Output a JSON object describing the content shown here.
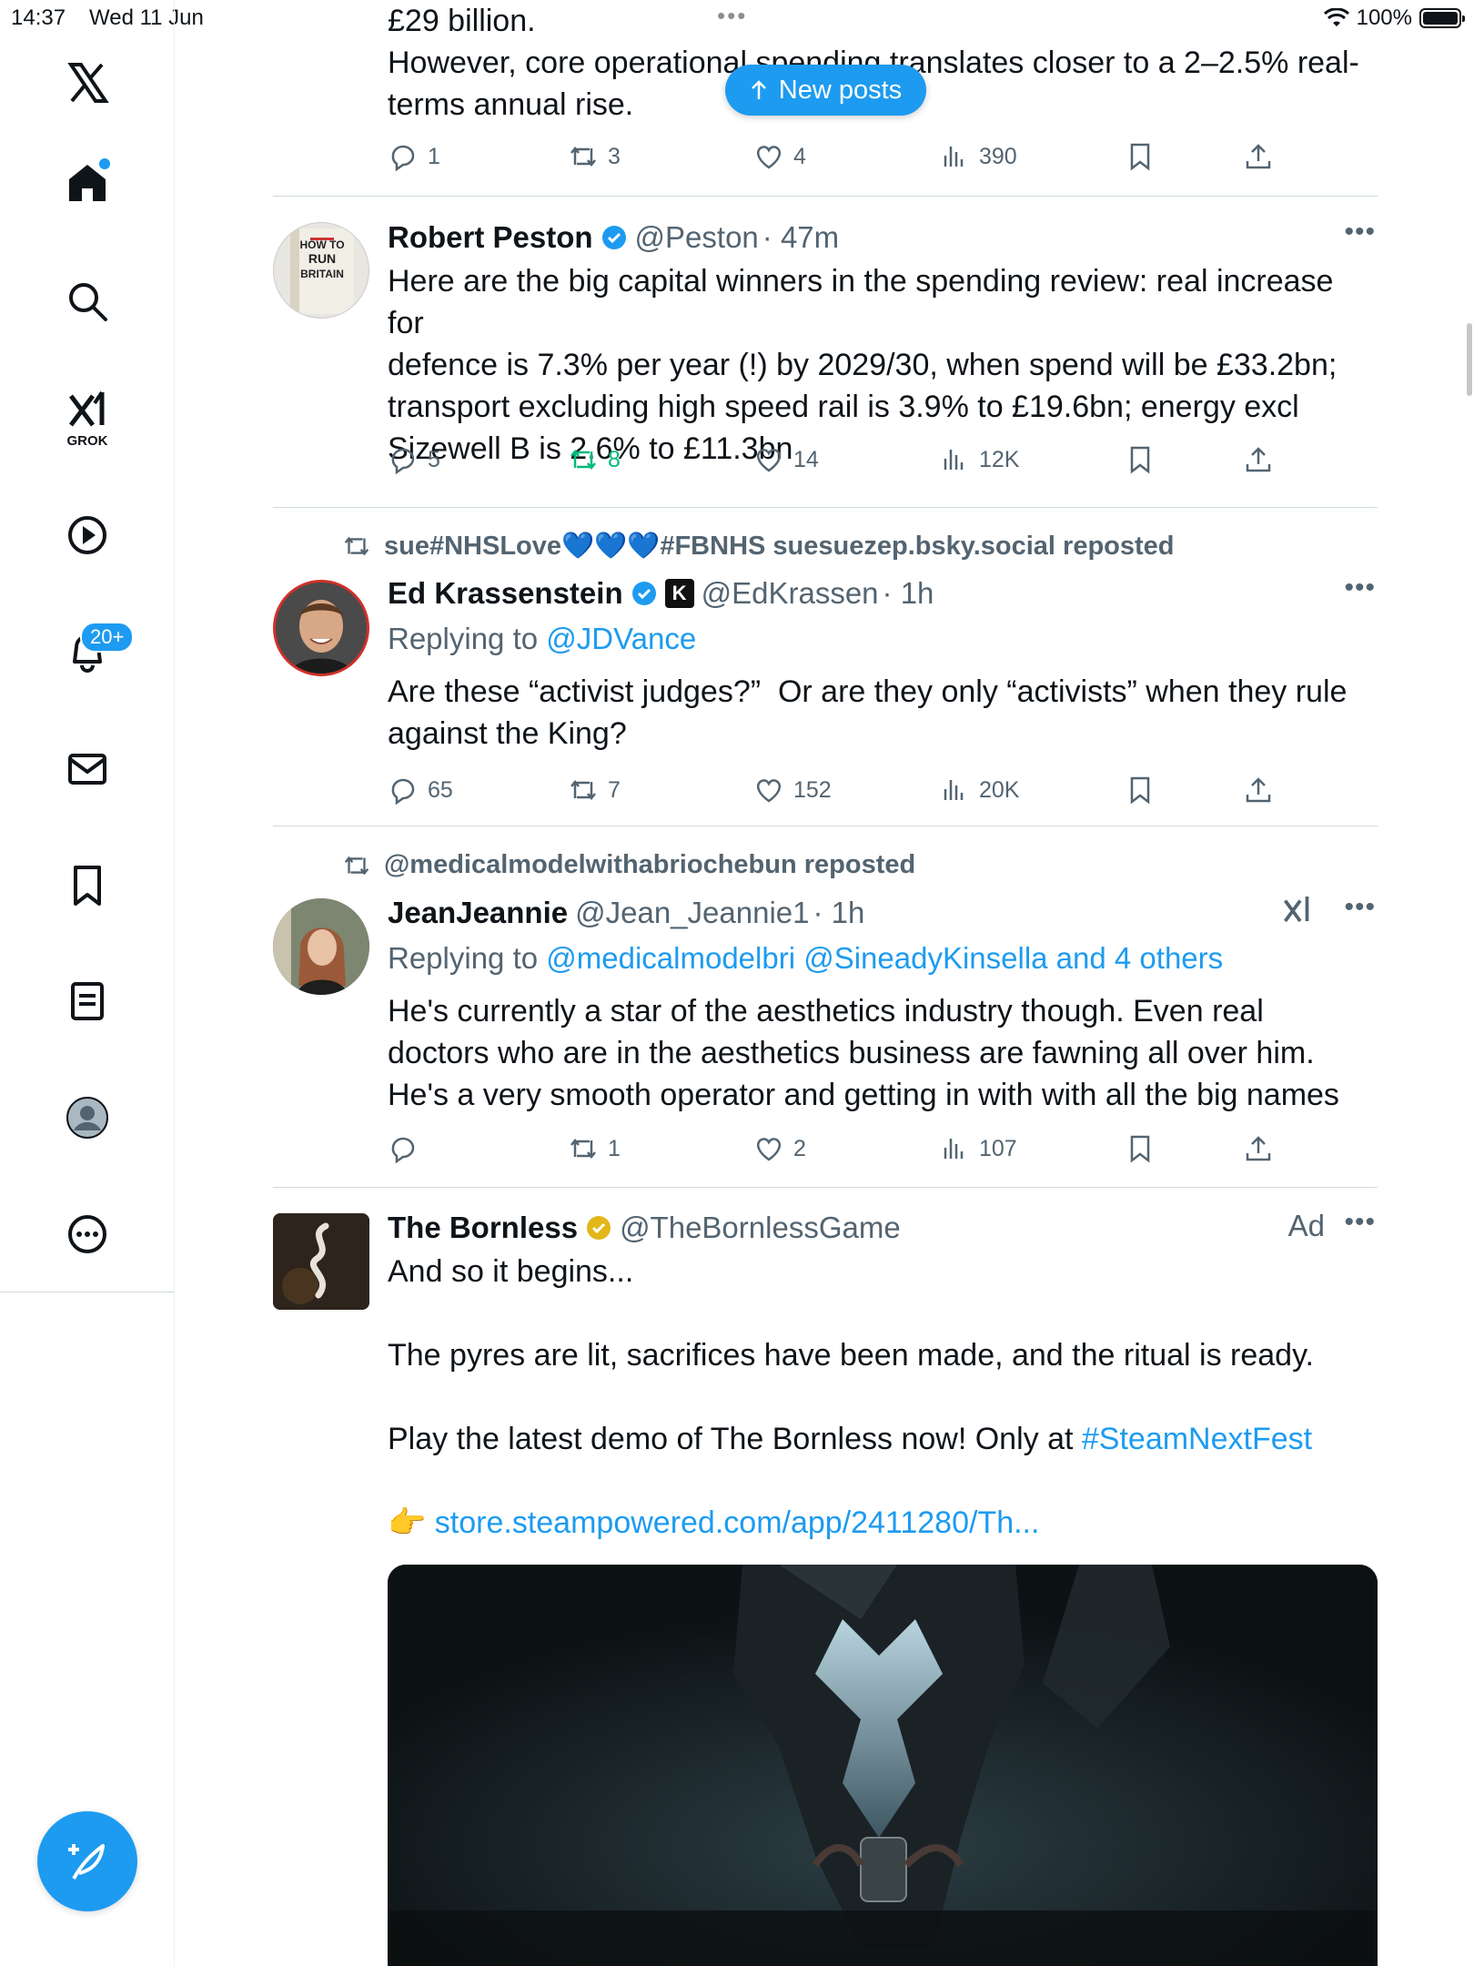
{
  "status": {
    "time": "14:37",
    "date": "Wed 11 Jun",
    "battery": "100%",
    "dots": "•••"
  },
  "nav": {
    "notif_count": "20+",
    "grok_label": "GROK"
  },
  "new_posts_label": "New posts",
  "top_tweet": {
    "line1": "£29 billion.",
    "line2": "However, core operational spending translates closer to a 2–2.5% real-",
    "line3": "terms annual rise.",
    "replies": "1",
    "reposts": "3",
    "likes": "4",
    "views": "390"
  },
  "tweets": [
    {
      "name": "Robert Peston",
      "handle": "@Peston",
      "time": "· 47m",
      "avatar_text": "HOW TO RUN BRITAIN",
      "lines": [
        "Here are the big capital winners in the spending review: real increase for",
        "defence is 7.3% per year (!) by 2029/30, when spend will be £33.2bn;",
        "transport excluding high speed rail is 3.9% to £19.6bn; energy excl",
        "Sizewell B is 2.6% to £11.3bn"
      ],
      "replies": "5",
      "reposts": "8",
      "likes": "14",
      "views": "12K"
    },
    {
      "repost_by": "sue#NHSLove💙💙💙#FBNHS suesuezep.bsky.social reposted",
      "name": "Ed Krassenstein",
      "badge": "K",
      "handle": "@EdKrassen",
      "time": "· 1h",
      "reply_prefix": "Replying to ",
      "reply_to": "@JDVance",
      "lines": [
        "Are these “activist judges?”  Or are they only “activists” when they rule",
        "against the King?"
      ],
      "replies": "65",
      "reposts": "7",
      "likes": "152",
      "views": "20K"
    },
    {
      "repost_by": "@medicalmodelwithabriochebun reposted",
      "name": "JeanJeannie",
      "handle": "@Jean_Jeannie1",
      "time": "· 1h",
      "reply_prefix": "Replying to ",
      "reply_to": "@medicalmodelbri @SineadyKinsella and 4 others",
      "lines": [
        "He's currently a star of the aesthetics industry though. Even real",
        "doctors who are in the aesthetics business are fawning all over him.",
        "He's a very smooth operator and getting in with with all the big names"
      ],
      "replies": "",
      "reposts": "1",
      "likes": "2",
      "views": "107"
    },
    {
      "name": "The Bornless",
      "handle": "@TheBornlessGame",
      "ad_label": "Ad",
      "line1": "And so it begins...",
      "line2": "The pyres are lit, sacrifices have been made, and the ritual is ready.",
      "line3_prefix": "Play the latest demo of The Bornless now! Only at ",
      "hashtag": "#SteamNextFest",
      "link_emoji": "👉",
      "link": "store.steampowered.com/app/2411280/Th..."
    }
  ]
}
